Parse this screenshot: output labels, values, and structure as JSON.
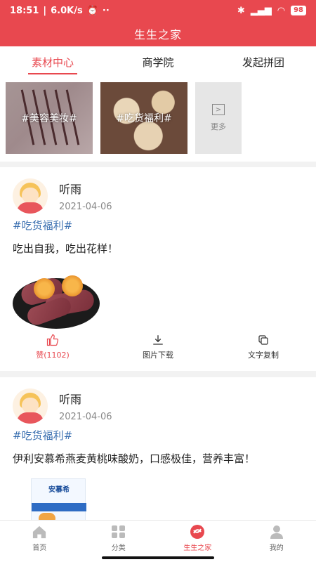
{
  "status_bar": {
    "time": "18:51",
    "network": "6.0K/s",
    "battery": "98"
  },
  "app_title": "生生之家",
  "tabs": [
    {
      "label": "素材中心",
      "active": true
    },
    {
      "label": "商学院",
      "active": false
    },
    {
      "label": "发起拼团",
      "active": false
    }
  ],
  "materials": {
    "items": [
      {
        "label": "#美容美妆#"
      },
      {
        "label": "#吃货福利#"
      }
    ],
    "more_label": "更多"
  },
  "posts": [
    {
      "author": "听雨",
      "date": "2021-04-06",
      "tag": "#吃货福利#",
      "content": "吃出自我，吃出花样！",
      "actions": {
        "like": "赞(1102)",
        "download": "图片下载",
        "copy": "文字复制"
      }
    },
    {
      "author": "听雨",
      "date": "2021-04-06",
      "tag": "#吃货福利#",
      "content": "伊利安慕希燕麦黄桃味酸奶，口感极佳，营养丰富！",
      "product_brand": "安慕希"
    }
  ],
  "bottom_nav": [
    {
      "label": "首页",
      "icon": "home-icon",
      "active": false
    },
    {
      "label": "分类",
      "icon": "grid-icon",
      "active": false
    },
    {
      "label": "生生之家",
      "icon": "brand-icon",
      "active": true
    },
    {
      "label": "我的",
      "icon": "user-icon",
      "active": false
    }
  ],
  "colors": {
    "accent": "#e8484f",
    "tag": "#3a6fb0"
  }
}
